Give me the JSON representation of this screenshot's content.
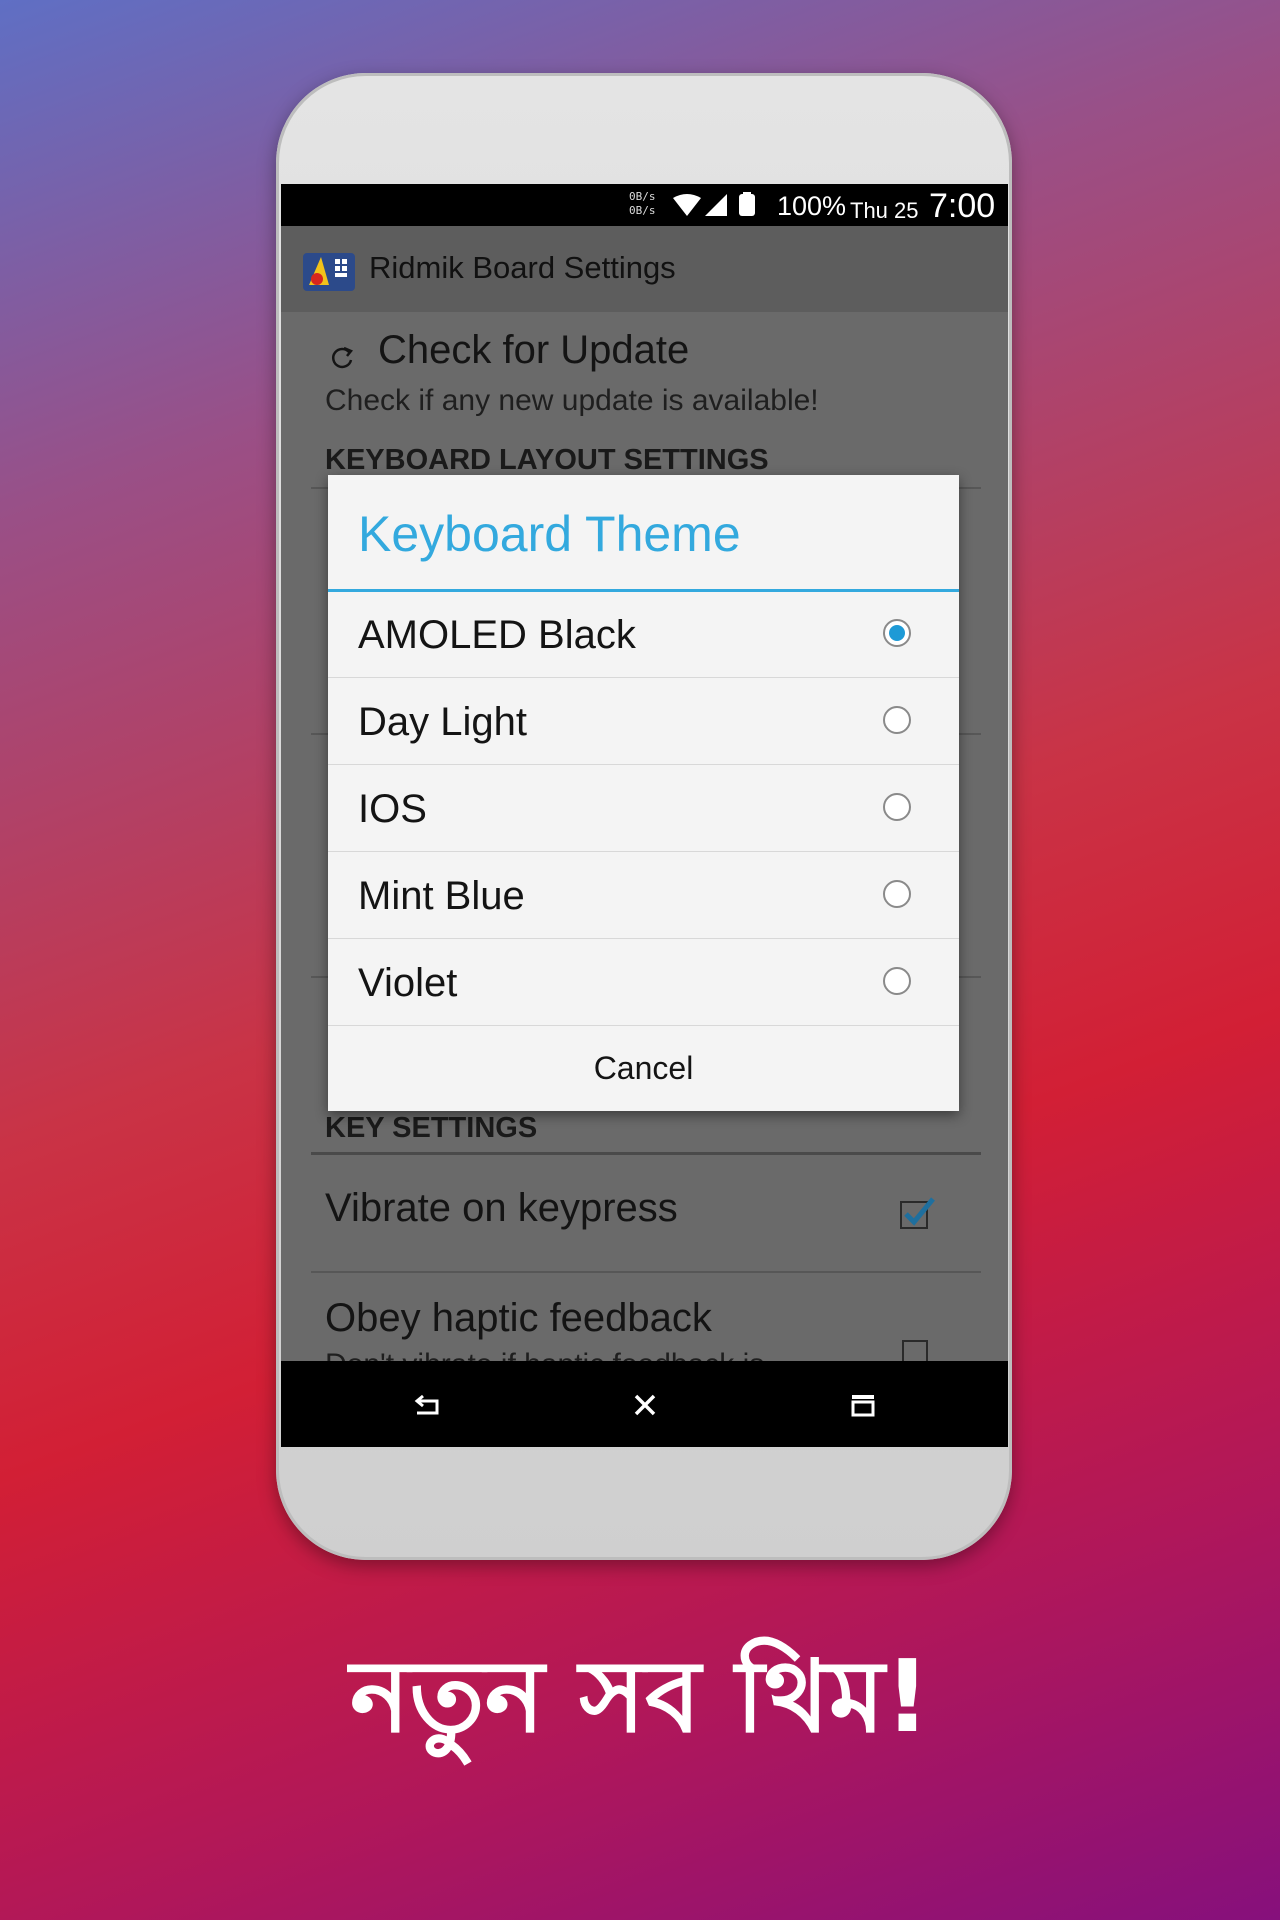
{
  "status_bar": {
    "net_up": "0B/s",
    "net_down": "0B/s",
    "battery": "100%",
    "date": "Thu 25",
    "time": "7:00"
  },
  "app_bar": {
    "title": "Ridmik Board Settings"
  },
  "settings": {
    "check_update": {
      "title": "Check for Update",
      "summary": "Check if any new update is available!"
    },
    "layout_header": "KEYBOARD LAYOUT SETTINGS",
    "key_header": "KEY SETTINGS",
    "vibrate": {
      "title": "Vibrate on keypress",
      "checked": true
    },
    "haptic": {
      "title": "Obey haptic feedback",
      "summary": "Don't vibrate if haptic feedback is",
      "checked": false
    }
  },
  "dialog": {
    "title": "Keyboard Theme",
    "options": [
      {
        "label": "AMOLED Black",
        "selected": true
      },
      {
        "label": "Day Light",
        "selected": false
      },
      {
        "label": "IOS",
        "selected": false
      },
      {
        "label": "Mint Blue",
        "selected": false
      },
      {
        "label": "Violet",
        "selected": false
      }
    ],
    "cancel_label": "Cancel"
  },
  "nav_bar": {
    "icons": [
      "back-icon",
      "home-icon",
      "recents-icon"
    ]
  },
  "tagline": "নতুন সব থিম!",
  "colors": {
    "accent": "#33a9de",
    "radio_selected": "#1e9ad6",
    "checkbox": "#1f6f9e"
  }
}
